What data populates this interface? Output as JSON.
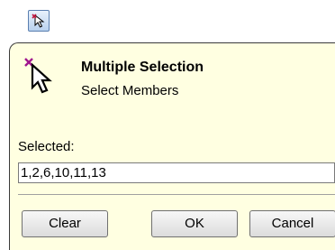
{
  "toolbar": {
    "tool_icon": "multiple-selection-pointer-icon"
  },
  "dialog": {
    "icon": "multi-select-cursor-icon",
    "title": "Multiple Selection",
    "subtitle": "Select Members",
    "selected_label": "Selected:",
    "selected_value": "1,2,6,10,11,13",
    "buttons": {
      "clear": "Clear",
      "ok": "OK",
      "cancel": "Cancel"
    }
  },
  "colors": {
    "dialog_background": "#ffffe1",
    "tool_button_gradient_top": "#e8f1fc",
    "tool_button_gradient_bottom": "#b9d1ee",
    "marker_accent": "#a0168e"
  }
}
